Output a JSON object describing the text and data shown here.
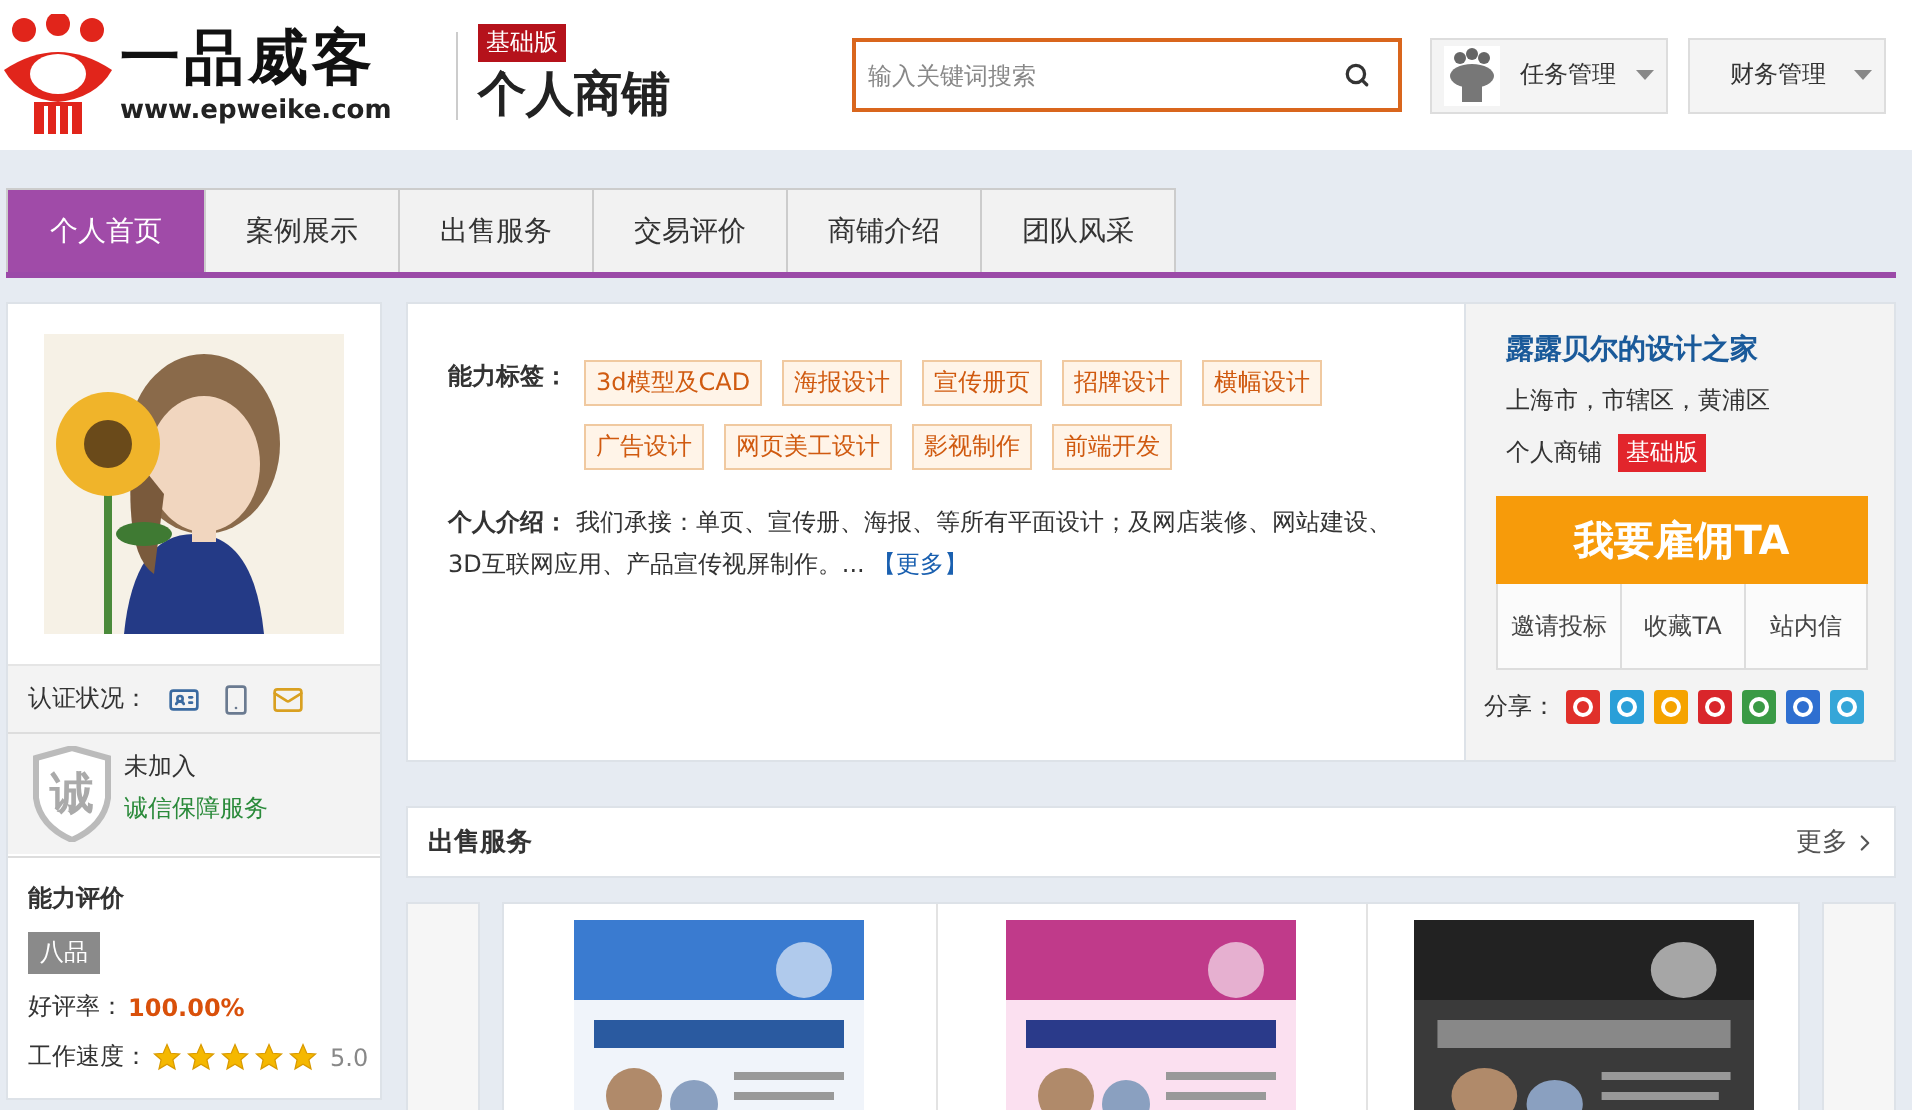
{
  "header": {
    "logo_text": "一品威客",
    "logo_url": "www.epweike.com",
    "edition_badge": "基础版",
    "page_title": "个人商铺",
    "search": {
      "placeholder": "输入关键词搜索"
    },
    "menus": [
      {
        "label": "任务管理",
        "kind": "avatar"
      },
      {
        "label": "财务管理",
        "kind": "plain"
      }
    ]
  },
  "tabs": [
    {
      "label": "个人首页",
      "selected": true
    },
    {
      "label": "案例展示",
      "selected": false
    },
    {
      "label": "出售服务",
      "selected": false
    },
    {
      "label": "交易评价",
      "selected": false
    },
    {
      "label": "商铺介绍",
      "selected": false
    },
    {
      "label": "团队风采",
      "selected": false
    }
  ],
  "profile": {
    "certification_label": "认证状况：",
    "integrity": {
      "seal": "诚",
      "status": "未加入",
      "link": "诚信保障服务"
    },
    "rating": {
      "title": "能力评价",
      "grade": "八品",
      "praise_label": "好评率：",
      "praise_value": "100.00%",
      "speed_label": "工作速度：",
      "stars": 5,
      "speed_value": "5.0"
    }
  },
  "skills": {
    "label": "能力标签：",
    "tags": [
      "3d模型及CAD",
      "海报设计",
      "宣传册页",
      "招牌设计",
      "横幅设计",
      "广告设计",
      "网页美工设计",
      "影视制作",
      "前端开发"
    ]
  },
  "intro": {
    "label": "个人介绍：",
    "text": "我们承接：单页、宣传册、海报、等所有平面设计；及网店装修、网站建设、3D互联网应用、产品宣传视屏制作。...",
    "more": "【更多】"
  },
  "shop": {
    "name": "露露贝尔的设计之家",
    "location": "上海市，市辖区，黄浦区",
    "type": "个人商铺",
    "edition_badge": "基础版",
    "hire_button": "我要雇佣TA",
    "actions": [
      "邀请投标",
      "收藏TA",
      "站内信"
    ],
    "share_label": "分享：",
    "share_icons": [
      {
        "color": "#e0302a"
      },
      {
        "color": "#2a9fd8"
      },
      {
        "color": "#f5a300"
      },
      {
        "color": "#d9262b"
      },
      {
        "color": "#3a9a45"
      },
      {
        "color": "#2f6fd0"
      },
      {
        "color": "#35a6d8"
      }
    ]
  },
  "services": {
    "title": "出售服务",
    "more": "更多"
  }
}
